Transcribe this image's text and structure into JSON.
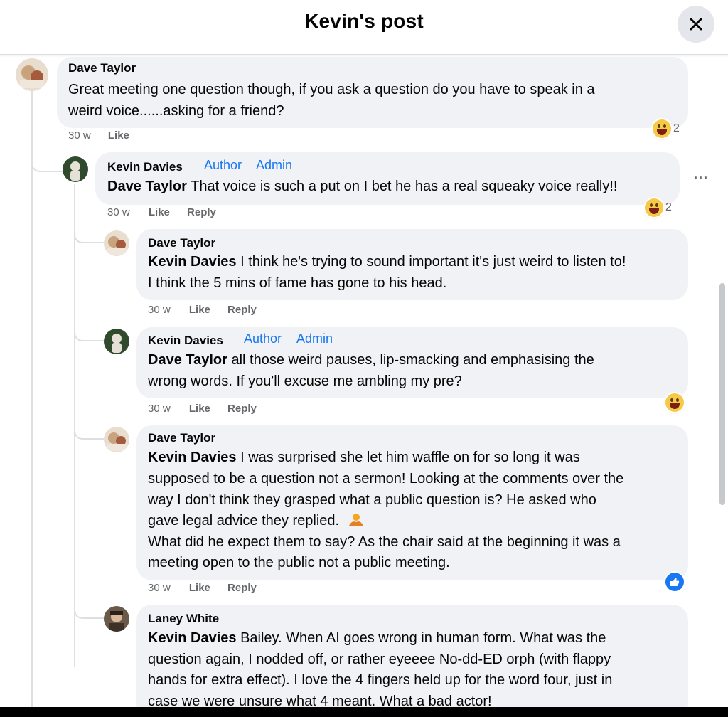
{
  "header": {
    "title": "Kevin's post"
  },
  "comments": [
    {
      "author": "Dave Taylor",
      "lines": [
        "Great meeting one question though, if you ask a question do you have to speak in a",
        "weird voice......asking for a friend?"
      ],
      "time": "30 w",
      "like": "Like",
      "reactions": "2"
    },
    {
      "author": "Kevin Davies",
      "badge_author": "Author",
      "badge_admin": "Admin",
      "mention": "Dave Taylor",
      "lines": [
        "That voice is such a put on I bet he has a real squeaky voice really!!"
      ],
      "time": "30 w",
      "like": "Like",
      "reply": "Reply",
      "reactions": "2",
      "more": "···"
    },
    {
      "author": "Dave Taylor",
      "mention": "Kevin Davies",
      "lines": [
        "I think he's trying to sound important it's just weird to listen to!",
        "I think the 5 mins of fame has gone to his head."
      ],
      "time": "30 w",
      "like": "Like",
      "reply": "Reply"
    },
    {
      "author": "Kevin Davies",
      "badge_author": "Author",
      "badge_admin": "Admin",
      "mention": "Dave Taylor",
      "lines": [
        "all those weird pauses, lip-smacking and emphasising the",
        "wrong words. If you'll excuse me ambling my pre?"
      ],
      "time": "30 w",
      "like": "Like",
      "reply": "Reply"
    },
    {
      "author": "Dave Taylor",
      "mention": "Kevin Davies",
      "lines": [
        "I was surprised she let him waffle on for so long it was",
        "supposed to be a question not a sermon! Looking at the comments over the",
        "way I don't think they grasped what a public question is? He asked who",
        "gave legal advice they replied.",
        "What did he expect them to say? As the chair said at the beginning it was a",
        "meeting open to the public not a public meeting."
      ],
      "time": "30 w",
      "like": "Like",
      "reply": "Reply"
    },
    {
      "author": "Laney White",
      "mention": "Kevin Davies",
      "lines": [
        "Bailey. When AI goes wrong in human form. What was the",
        "question again, I nodded off, or rather eyeeee No-dd-ED orph (with flappy",
        "hands for extra effect). I love the 4 fingers held up for the word four, just in",
        "case we were unsure what 4 meant. What a bad actor!"
      ]
    }
  ],
  "icons": {
    "close": "close-icon",
    "haha": "haha-reaction-icon",
    "like": "like-reaction-icon",
    "shrug": "shrug-emoji-icon"
  },
  "colors": {
    "badge": "#1877f2",
    "bubble": "#f0f2f5",
    "meta": "#65676b"
  }
}
